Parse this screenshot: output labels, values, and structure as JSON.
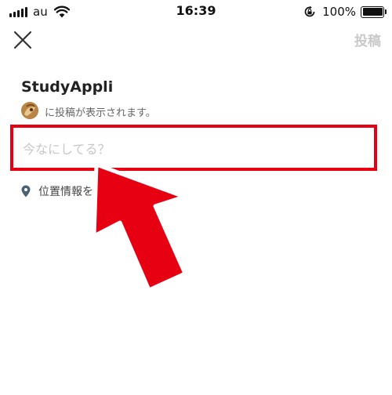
{
  "status_bar": {
    "carrier": "au",
    "time": "16:39",
    "battery_percent": "100%",
    "battery_level": 1.0
  },
  "header": {
    "close_icon": "close-icon",
    "post_label": "投稿"
  },
  "account": {
    "name": "StudyAppli",
    "visibility_note": "に投稿が表示されます。"
  },
  "compose": {
    "placeholder": "今なにしてる？",
    "value": ""
  },
  "location": {
    "icon": "location-pin-icon",
    "label": "位置情報を"
  },
  "colors": {
    "highlight": "#e60012",
    "post_disabled": "#c9c9c9",
    "pin": "#4a6275"
  }
}
